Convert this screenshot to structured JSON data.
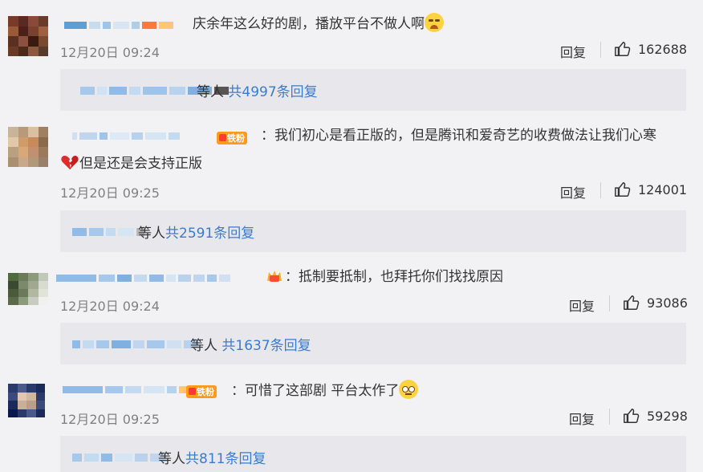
{
  "comments": [
    {
      "text": "庆余年这么好的剧，播放平台不做人啊",
      "time": "12月20日 09:24",
      "reply": "回复",
      "likes": "162688",
      "replies_suffix": "等人",
      "replies_link": "共4997条回复"
    },
    {
      "badge": "铁粉",
      "text": "：我们初心是看正版的，但是腾讯和爱奇艺的收费做法让我们心寒",
      "text2": "但是还是会支持正版",
      "time": "12月20日 09:25",
      "reply": "回复",
      "likes": "124001",
      "replies_suffix": "等人",
      "replies_link": "共2591条回复"
    },
    {
      "text": "：抵制要抵制，也拜托你们找找原因",
      "time": "12月20日 09:24",
      "reply": "回复",
      "likes": "93086",
      "replies_suffix": "等人",
      "replies_link": "共1637条回复"
    },
    {
      "badge": "铁粉",
      "text": "：可惜了这部剧 平台太作了",
      "time": "12月20日 09:25",
      "reply": "回复",
      "likes": "59298",
      "replies_suffix": "等人",
      "replies_link": "共811条回复"
    }
  ],
  "colors": {
    "link": "#3a7bd0",
    "badge": "#ff9a1e",
    "bg": "#f2f2f5",
    "reply_box": "#e8e8ec"
  },
  "icons": {
    "like": "thumbs-up-icon",
    "cry": "crying-emoji-icon",
    "heart": "broken-heart-icon",
    "crown": "crown-icon",
    "huh": "doubt-emoji-icon"
  }
}
